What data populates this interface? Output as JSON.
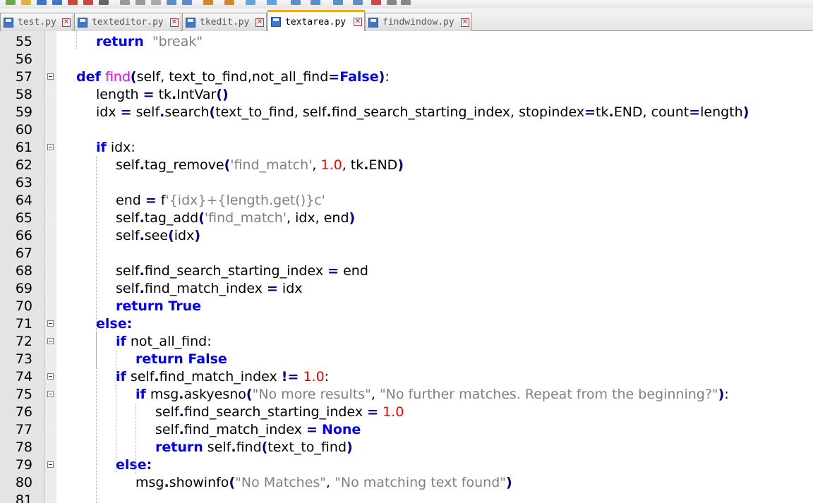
{
  "toolbar": {
    "icons": [
      "new-file-icon",
      "open-file-icon",
      "save-icon",
      "save-all-icon",
      "close-icon",
      "close-all-icon",
      "print-icon",
      "cut-icon",
      "copy-icon",
      "paste-icon",
      "undo-icon",
      "redo-icon",
      "find-icon",
      "replace-icon",
      "zoom-in-icon",
      "zoom-out-icon",
      "sync-scroll-icon",
      "word-wrap-icon",
      "show-all-chars-icon",
      "indent-guide-icon",
      "record-macro-icon",
      "stop-macro-icon",
      "play-macro-icon"
    ]
  },
  "tabs": [
    {
      "label": "test.py",
      "active": false
    },
    {
      "label": "texteditor.py",
      "active": false
    },
    {
      "label": "tkedit.py",
      "active": false
    },
    {
      "label": "textarea.py",
      "active": true
    },
    {
      "label": "findwindow.py",
      "active": false
    }
  ],
  "tab_close_glyph": "✕",
  "colors": {
    "keyword": "#0000ff",
    "function_name": "#ff00ff",
    "string": "#808080",
    "number": "#ff0000",
    "operator": "#000080",
    "active_tab_accent": "#f5a623",
    "gutter": "#e4e4e4"
  },
  "editor": {
    "lines": [
      {
        "n": "55",
        "fold": false,
        "tokens": [
          [
            "kw",
            "return"
          ],
          [
            "",
            "  "
          ],
          [
            "str",
            "\"break\""
          ]
        ]
      },
      {
        "n": "56",
        "fold": false,
        "tokens": []
      },
      {
        "n": "57",
        "fold": true,
        "tokens": [
          [
            "def",
            "def"
          ],
          [
            "",
            " "
          ],
          [
            "fn",
            "find"
          ],
          [
            "op",
            "("
          ],
          [
            "",
            "self, text_to_find,not_all_find"
          ],
          [
            "op",
            "="
          ],
          [
            "kw",
            "False"
          ],
          [
            "op",
            ")"
          ],
          [
            "",
            ":"
          ]
        ]
      },
      {
        "n": "58",
        "fold": false,
        "tokens": [
          [
            "",
            "length "
          ],
          [
            "op",
            "="
          ],
          [
            "",
            " tk"
          ],
          [
            "op",
            "."
          ],
          [
            "",
            "IntVar"
          ],
          [
            "op",
            "()"
          ]
        ]
      },
      {
        "n": "59",
        "fold": false,
        "tokens": [
          [
            "",
            "idx "
          ],
          [
            "op",
            "="
          ],
          [
            "",
            " self"
          ],
          [
            "op",
            "."
          ],
          [
            "",
            "search"
          ],
          [
            "op",
            "("
          ],
          [
            "",
            "text_to_find, self"
          ],
          [
            "op",
            "."
          ],
          [
            "",
            "find_search_starting_index, stopindex"
          ],
          [
            "op",
            "="
          ],
          [
            "",
            "tk"
          ],
          [
            "op",
            "."
          ],
          [
            "",
            "END, count"
          ],
          [
            "op",
            "="
          ],
          [
            "",
            "length"
          ],
          [
            "op",
            ")"
          ]
        ]
      },
      {
        "n": "60",
        "fold": false,
        "tokens": []
      },
      {
        "n": "61",
        "fold": true,
        "tokens": [
          [
            "kw",
            "if"
          ],
          [
            "",
            " idx:"
          ]
        ]
      },
      {
        "n": "62",
        "fold": false,
        "tokens": [
          [
            "",
            "self"
          ],
          [
            "op",
            "."
          ],
          [
            "",
            "tag_remove"
          ],
          [
            "op",
            "("
          ],
          [
            "str",
            "'find_match'"
          ],
          [
            "",
            ", "
          ],
          [
            "num",
            "1.0"
          ],
          [
            "",
            ", tk"
          ],
          [
            "op",
            "."
          ],
          [
            "",
            "END"
          ],
          [
            "op",
            ")"
          ]
        ]
      },
      {
        "n": "63",
        "fold": false,
        "tokens": []
      },
      {
        "n": "64",
        "fold": false,
        "tokens": [
          [
            "",
            "end "
          ],
          [
            "op",
            "="
          ],
          [
            "",
            " f"
          ],
          [
            "str",
            "'{idx}+{length.get()}c'"
          ]
        ]
      },
      {
        "n": "65",
        "fold": false,
        "tokens": [
          [
            "",
            "self"
          ],
          [
            "op",
            "."
          ],
          [
            "",
            "tag_add"
          ],
          [
            "op",
            "("
          ],
          [
            "str",
            "'find_match'"
          ],
          [
            "",
            ", idx, end"
          ],
          [
            "op",
            ")"
          ]
        ]
      },
      {
        "n": "66",
        "fold": false,
        "tokens": [
          [
            "",
            "self"
          ],
          [
            "op",
            "."
          ],
          [
            "",
            "see"
          ],
          [
            "op",
            "("
          ],
          [
            "",
            "idx"
          ],
          [
            "op",
            ")"
          ]
        ]
      },
      {
        "n": "67",
        "fold": false,
        "tokens": []
      },
      {
        "n": "68",
        "fold": false,
        "tokens": [
          [
            "",
            "self"
          ],
          [
            "op",
            "."
          ],
          [
            "",
            "find_search_starting_index "
          ],
          [
            "op",
            "="
          ],
          [
            "",
            " end"
          ]
        ]
      },
      {
        "n": "69",
        "fold": false,
        "tokens": [
          [
            "",
            "self"
          ],
          [
            "op",
            "."
          ],
          [
            "",
            "find_match_index "
          ],
          [
            "op",
            "="
          ],
          [
            "",
            " idx"
          ]
        ]
      },
      {
        "n": "70",
        "fold": false,
        "tokens": [
          [
            "kw",
            "return True"
          ]
        ]
      },
      {
        "n": "71",
        "fold": true,
        "tokens": [
          [
            "kw",
            "else"
          ],
          [
            "op",
            ":"
          ]
        ]
      },
      {
        "n": "72",
        "fold": true,
        "tokens": [
          [
            "kw",
            "if"
          ],
          [
            "",
            " not_all_find:"
          ]
        ]
      },
      {
        "n": "73",
        "fold": false,
        "tokens": [
          [
            "kw",
            "return False"
          ]
        ]
      },
      {
        "n": "74",
        "fold": true,
        "tokens": [
          [
            "kw",
            "if"
          ],
          [
            "",
            " self"
          ],
          [
            "op",
            "."
          ],
          [
            "",
            "find_match_index "
          ],
          [
            "op",
            "!="
          ],
          [
            "",
            " "
          ],
          [
            "num",
            "1.0"
          ],
          [
            "",
            ":"
          ]
        ]
      },
      {
        "n": "75",
        "fold": true,
        "tokens": [
          [
            "kw",
            "if"
          ],
          [
            "",
            " msg"
          ],
          [
            "op",
            "."
          ],
          [
            "",
            "askyesno"
          ],
          [
            "op",
            "("
          ],
          [
            "str",
            "\"No more results\""
          ],
          [
            "",
            ", "
          ],
          [
            "str",
            "\"No further matches. Repeat from the beginning?\""
          ],
          [
            "op",
            ")"
          ],
          [
            "",
            ":"
          ]
        ]
      },
      {
        "n": "76",
        "fold": false,
        "tokens": [
          [
            "",
            "self"
          ],
          [
            "op",
            "."
          ],
          [
            "",
            "find_search_starting_index "
          ],
          [
            "op",
            "="
          ],
          [
            "",
            " "
          ],
          [
            "num",
            "1.0"
          ]
        ]
      },
      {
        "n": "77",
        "fold": false,
        "tokens": [
          [
            "",
            "self"
          ],
          [
            "op",
            "."
          ],
          [
            "",
            "find_match_index "
          ],
          [
            "op",
            "="
          ],
          [
            "",
            " "
          ],
          [
            "kw",
            "None"
          ]
        ]
      },
      {
        "n": "78",
        "fold": false,
        "tokens": [
          [
            "kw",
            "return"
          ],
          [
            "",
            " self"
          ],
          [
            "op",
            "."
          ],
          [
            "",
            "find"
          ],
          [
            "op",
            "("
          ],
          [
            "",
            "text_to_find"
          ],
          [
            "op",
            ")"
          ]
        ]
      },
      {
        "n": "79",
        "fold": true,
        "tokens": [
          [
            "kw",
            "else"
          ],
          [
            "op",
            ":"
          ]
        ]
      },
      {
        "n": "80",
        "fold": false,
        "tokens": [
          [
            "",
            "msg"
          ],
          [
            "op",
            "."
          ],
          [
            "",
            "showinfo"
          ],
          [
            "op",
            "("
          ],
          [
            "str",
            "\"No Matches\""
          ],
          [
            "",
            ", "
          ],
          [
            "str",
            "\"No matching text found\""
          ],
          [
            "op",
            ")"
          ]
        ]
      },
      {
        "n": "81",
        "fold": false,
        "tokens": []
      }
    ]
  }
}
